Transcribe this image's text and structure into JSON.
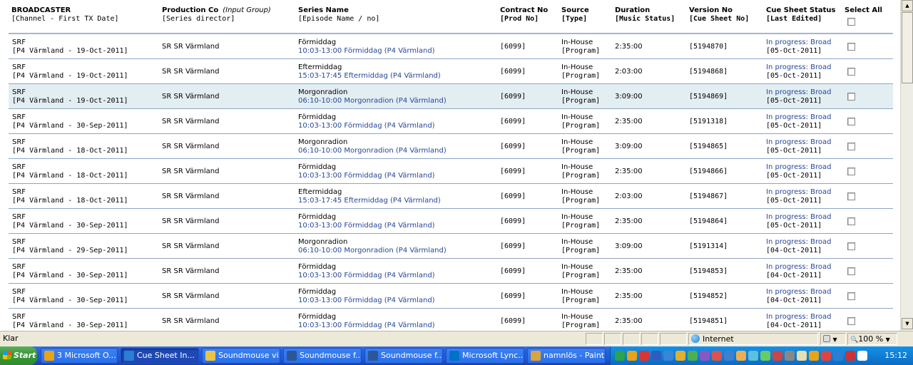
{
  "headers": {
    "broadcaster": {
      "title": "BROADCASTER",
      "sub": "[Channel - First TX Date]"
    },
    "production": {
      "title": "Production Co",
      "title_extra": "(Input Group)",
      "sub": "[Series director]"
    },
    "series": {
      "title": "Series Name",
      "sub": "[Episode Name / no]"
    },
    "contract": {
      "title": "Contract No",
      "sub": "[Prod No]"
    },
    "source": {
      "title": "Source",
      "sub": "[Type]"
    },
    "duration": {
      "title": "Duration",
      "sub": "[Music Status]"
    },
    "version": {
      "title": "Version No",
      "sub": "[Cue Sheet No]"
    },
    "status": {
      "title": "Cue Sheet Status",
      "sub": "[Last Edited]"
    },
    "select_all": {
      "title": "Select All"
    }
  },
  "rows": [
    {
      "broadcaster": "SRF",
      "channel": "[P4 Värmland - 19-Oct-2011]",
      "production": "SR SR Värmland",
      "series": "Förmiddag",
      "episode": "10:03-13:00 Förmiddag (P4 Värmland)",
      "contract": "[6099]",
      "source": "In-House",
      "type": "[Program]",
      "duration": "2:35:00",
      "version": "[5194870]",
      "status": "In progress: Broad",
      "edited": "[05-Oct-2011]"
    },
    {
      "broadcaster": "SRF",
      "channel": "[P4 Värmland - 19-Oct-2011]",
      "production": "SR SR Värmland",
      "series": "Eftermiddag",
      "episode": "15:03-17:45 Eftermiddag (P4 Värmland)",
      "contract": "[6099]",
      "source": "In-House",
      "type": "[Program]",
      "duration": "2:03:00",
      "version": "[5194868]",
      "status": "In progress: Broad",
      "edited": "[05-Oct-2011]"
    },
    {
      "broadcaster": "SRF",
      "channel": "[P4 Värmland - 19-Oct-2011]",
      "production": "SR SR Värmland",
      "series": "Morgonradion",
      "episode": "06:10-10:00 Morgonradion (P4 Värmland)",
      "contract": "[6099]",
      "source": "In-House",
      "type": "[Program]",
      "duration": "3:09:00",
      "version": "[5194869]",
      "status": "In progress: Broad",
      "edited": "[05-Oct-2011]",
      "highlight": true
    },
    {
      "broadcaster": "SRF",
      "channel": "[P4 Värmland - 30-Sep-2011]",
      "production": "SR SR Värmland",
      "series": "Förmiddag",
      "episode": "10:03-13:00 Förmiddag (P4 Värmland)",
      "contract": "[6099]",
      "source": "In-House",
      "type": "[Program]",
      "duration": "2:35:00",
      "version": "[5191318]",
      "status": "In progress: Broad",
      "edited": "[05-Oct-2011]"
    },
    {
      "broadcaster": "SRF",
      "channel": "[P4 Värmland - 18-Oct-2011]",
      "production": "SR SR Värmland",
      "series": "Morgonradion",
      "episode": "06:10-10:00 Morgonradion (P4 Värmland)",
      "contract": "[6099]",
      "source": "In-House",
      "type": "[Program]",
      "duration": "3:09:00",
      "version": "[5194865]",
      "status": "In progress: Broad",
      "edited": "[05-Oct-2011]"
    },
    {
      "broadcaster": "SRF",
      "channel": "[P4 Värmland - 18-Oct-2011]",
      "production": "SR SR Värmland",
      "series": "Förmiddag",
      "episode": "10:03-13:00 Förmiddag (P4 Värmland)",
      "contract": "[6099]",
      "source": "In-House",
      "type": "[Program]",
      "duration": "2:35:00",
      "version": "[5194866]",
      "status": "In progress: Broad",
      "edited": "[05-Oct-2011]"
    },
    {
      "broadcaster": "SRF",
      "channel": "[P4 Värmland - 18-Oct-2011]",
      "production": "SR SR Värmland",
      "series": "Eftermiddag",
      "episode": "15:03-17:45 Eftermiddag (P4 Värmland)",
      "contract": "[6099]",
      "source": "In-House",
      "type": "[Program]",
      "duration": "2:03:00",
      "version": "[5194867]",
      "status": "In progress: Broad",
      "edited": "[05-Oct-2011]"
    },
    {
      "broadcaster": "SRF",
      "channel": "[P4 Värmland - 30-Sep-2011]",
      "production": "SR SR Värmland",
      "series": "Förmiddag",
      "episode": "10:03-13:00 Förmiddag (P4 Värmland)",
      "contract": "[6099]",
      "source": "In-House",
      "type": "[Program]",
      "duration": "2:35:00",
      "version": "[5194864]",
      "status": "In progress: Broad",
      "edited": "[05-Oct-2011]"
    },
    {
      "broadcaster": "SRF",
      "channel": "[P4 Värmland - 29-Sep-2011]",
      "production": "SR SR Värmland",
      "series": "Morgonradion",
      "episode": "06:10-10:00 Morgonradion (P4 Värmland)",
      "contract": "[6099]",
      "source": "In-House",
      "type": "[Program]",
      "duration": "3:09:00",
      "version": "[5191314]",
      "status": "In progress: Broad",
      "edited": "[04-Oct-2011]"
    },
    {
      "broadcaster": "SRF",
      "channel": "[P4 Värmland - 30-Sep-2011]",
      "production": "SR SR Värmland",
      "series": "Förmiddag",
      "episode": "10:03-13:00 Förmiddag (P4 Värmland)",
      "contract": "[6099]",
      "source": "In-House",
      "type": "[Program]",
      "duration": "2:35:00",
      "version": "[5194853]",
      "status": "In progress: Broad",
      "edited": "[04-Oct-2011]"
    },
    {
      "broadcaster": "SRF",
      "channel": "[P4 Värmland - 30-Sep-2011]",
      "production": "SR SR Värmland",
      "series": "Förmiddag",
      "episode": "10:03-13:00 Förmiddag (P4 Värmland)",
      "contract": "[6099]",
      "source": "In-House",
      "type": "[Program]",
      "duration": "2:35:00",
      "version": "[5194852]",
      "status": "In progress: Broad",
      "edited": "[04-Oct-2011]"
    },
    {
      "broadcaster": "SRF",
      "channel": "[P4 Värmland - 30-Sep-2011]",
      "production": "SR SR Värmland",
      "series": "Förmiddag",
      "episode": "10:03-13:00 Förmiddag (P4 Värmland)",
      "contract": "[6099]",
      "source": "In-House",
      "type": "[Program]",
      "duration": "2:35:00",
      "version": "[5194851]",
      "status": "In progress: Broad",
      "edited": "[04-Oct-2011]"
    }
  ],
  "statusbar": {
    "left": "Klar",
    "zone": "Internet",
    "zoom": "100 %"
  },
  "taskbar": {
    "start": "Start",
    "tasks": [
      {
        "label": "3 Microsoft O...",
        "icon": "outlook-icon",
        "color": "#e8a317"
      },
      {
        "label": "Cue Sheet In...",
        "icon": "ie-icon",
        "color": "#2a7fd4",
        "active": true
      },
      {
        "label": "Soundmouse vi...",
        "icon": "folder-icon",
        "color": "#e8c547"
      },
      {
        "label": "Soundmouse f...",
        "icon": "word-icon",
        "color": "#2b579a"
      },
      {
        "label": "Soundmouse f...",
        "icon": "word-icon",
        "color": "#2b579a"
      },
      {
        "label": "Microsoft Lync...",
        "icon": "lync-icon",
        "color": "#0072c6"
      },
      {
        "label": "namnlös - Paint",
        "icon": "paint-icon",
        "color": "#d9a441"
      }
    ],
    "clock": "15:12"
  },
  "colors": {
    "link": "#27479a",
    "row_border": "#8ea6c5",
    "highlight": "#e3eef3"
  }
}
